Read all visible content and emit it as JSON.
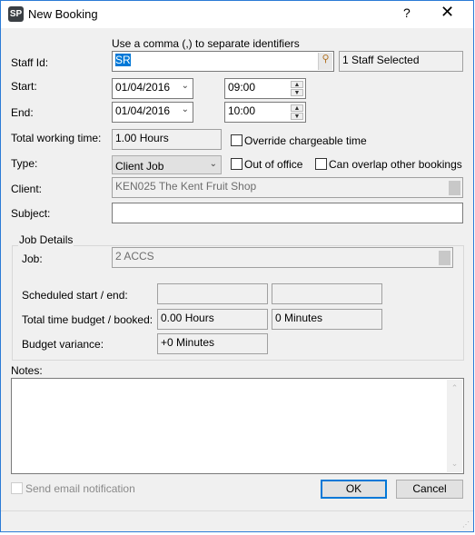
{
  "window": {
    "title": "New Booking",
    "logo": "SP",
    "help": "?",
    "close": "✕"
  },
  "form": {
    "hint": "Use a comma (,) to separate identifiers",
    "staff_label": "Staff Id:",
    "staff_value": "SR",
    "staff_selected": "1 Staff Selected",
    "start_label": "Start:",
    "start_date": "01/04/2016",
    "start_time": "09:00",
    "end_label": "End:",
    "end_date": "01/04/2016",
    "end_time": "10:00",
    "total_label": "Total working time:",
    "total_value": "1.00 Hours",
    "override_label": "Override chargeable time",
    "type_label": "Type:",
    "type_value": "Client Job",
    "out_of_office_label": "Out of office",
    "overlap_label": "Can overlap other bookings",
    "client_label": "Client:",
    "client_value": "KEN025 The Kent Fruit Shop",
    "subject_label": "Subject:",
    "subject_value": ""
  },
  "job": {
    "group_label": "Job Details",
    "job_label": "Job:",
    "job_value": "2 ACCS",
    "scheduled_label": "Scheduled start / end:",
    "scheduled_start": "",
    "scheduled_end": "",
    "budget_label": "Total time budget / booked:",
    "budget_value": "0.00 Hours",
    "booked_value": "0 Minutes",
    "variance_label": "Budget variance:",
    "variance_value": "+0 Minutes"
  },
  "notes": {
    "label": "Notes:",
    "value": ""
  },
  "footer": {
    "email_label": "Send email notification",
    "ok": "OK",
    "cancel": "Cancel"
  },
  "colors": {
    "accent": "#0078d7",
    "window_border": "#2b7bd6"
  }
}
